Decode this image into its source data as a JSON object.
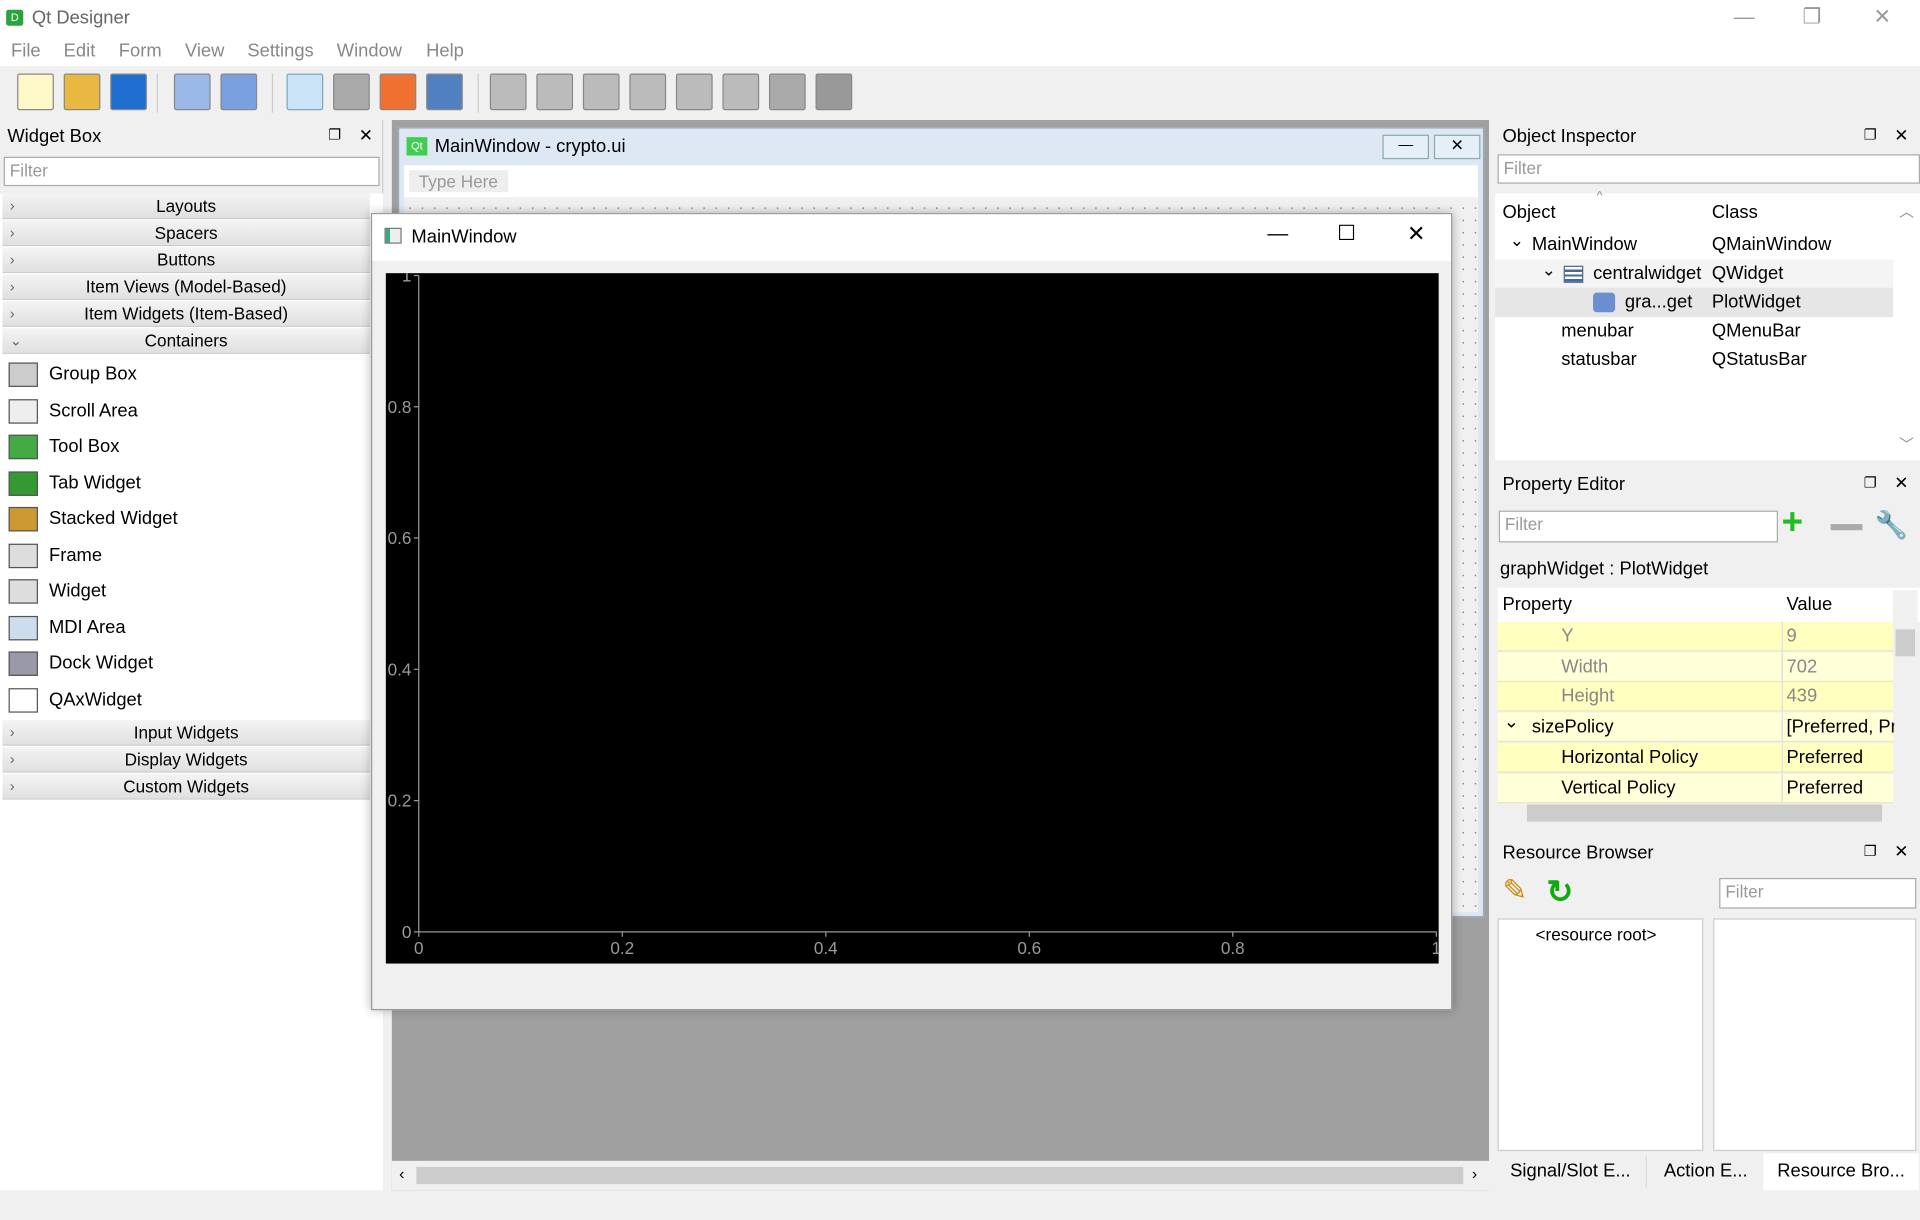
{
  "app": {
    "title": "Qt Designer",
    "icon": "D"
  },
  "menus": [
    "File",
    "Edit",
    "Form",
    "View",
    "Settings",
    "Window",
    "Help"
  ],
  "toolbar_icons": [
    "new-file-icon",
    "open-folder-icon",
    "save-icon",
    "send-to-back-icon",
    "bring-to-front-icon",
    "edit-widgets-icon",
    "edit-signals-slots-icon",
    "edit-buddies-icon",
    "edit-tab-order-icon",
    "layout-horizontal-icon",
    "layout-vertical-icon",
    "layout-horizontal-splitter-icon",
    "layout-vertical-splitter-icon",
    "layout-grid-icon",
    "layout-form-icon",
    "break-layout-icon",
    "adjust-size-icon"
  ],
  "widget_box": {
    "title": "Widget Box",
    "filter_placeholder": "Filter",
    "categories_top": [
      "Layouts",
      "Spacers",
      "Buttons",
      "Item Views (Model-Based)",
      "Item Widgets (Item-Based)"
    ],
    "open_category": "Containers",
    "items": [
      "Group Box",
      "Scroll Area",
      "Tool Box",
      "Tab Widget",
      "Stacked Widget",
      "Frame",
      "Widget",
      "MDI Area",
      "Dock Widget",
      "QAxWidget"
    ],
    "categories_bottom": [
      "Input Widgets",
      "Display Widgets",
      "Custom Widgets"
    ]
  },
  "form": {
    "title": "MainWindow - crypto.ui",
    "badge": "Qt",
    "menu_placeholder": "Type Here"
  },
  "preview": {
    "title": "MainWindow",
    "plot": {
      "y_ticks": [
        "0",
        "0.2",
        "0.4",
        "0.6",
        "0.8",
        "1"
      ],
      "x_ticks": [
        "0",
        "0.2",
        "0.4",
        "0.6",
        "0.8",
        "1"
      ],
      "xlim": [
        0,
        1
      ],
      "ylim": [
        0,
        1
      ],
      "background": "#000000"
    }
  },
  "object_inspector": {
    "title": "Object Inspector",
    "filter_placeholder": "Filter",
    "col_object": "Object",
    "col_class": "Class",
    "rows": [
      {
        "object": "MainWindow",
        "class": "QMainWindow"
      },
      {
        "object": "centralwidget",
        "class": "QWidget"
      },
      {
        "object": "gra...get",
        "class": "PlotWidget"
      },
      {
        "object": "menubar",
        "class": "QMenuBar"
      },
      {
        "object": "statusbar",
        "class": "QStatusBar"
      }
    ]
  },
  "property_editor": {
    "title": "Property Editor",
    "filter_placeholder": "Filter",
    "selected": "graphWidget : PlotWidget",
    "col_property": "Property",
    "col_value": "Value",
    "rows": [
      {
        "p": "Y",
        "v": "9"
      },
      {
        "p": "Width",
        "v": "702"
      },
      {
        "p": "Height",
        "v": "439"
      },
      {
        "p": "sizePolicy",
        "v": "[Preferred, Pre"
      },
      {
        "p": "Horizontal Policy",
        "v": "Preferred"
      },
      {
        "p": "Vertical Policy",
        "v": "Preferred"
      }
    ]
  },
  "resource_browser": {
    "title": "Resource Browser",
    "filter_placeholder": "Filter",
    "root": "<resource root>"
  },
  "bottom_tabs": [
    "Signal/Slot E...",
    "Action E...",
    "Resource Bro..."
  ],
  "colors": {
    "accent": "#cce4f7",
    "property_highlight": "#ffffc0",
    "plot_bg": "#000000"
  }
}
